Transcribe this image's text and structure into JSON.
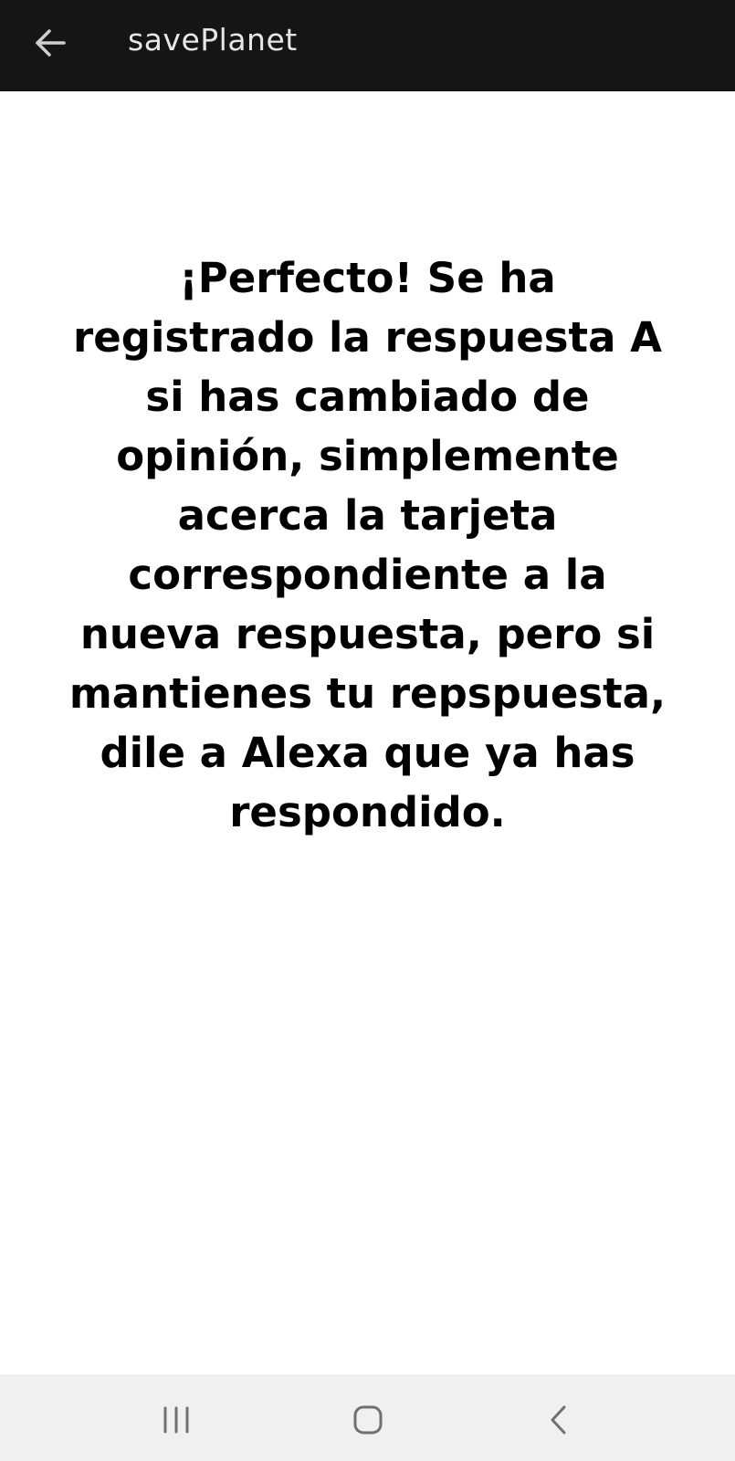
{
  "app_bar": {
    "title": "savePlanet",
    "back_icon": "arrow-left-icon"
  },
  "main": {
    "message": "¡Perfecto! Se ha registrado la respuesta A si has cambiado de opinión, simplemente acerca la tarjeta correspondiente a la nueva respuesta, pero si mantienes tu repspuesta, dile a Alexa que ya has respondido."
  },
  "system_nav": {
    "recents_icon": "recents-icon",
    "home_icon": "home-icon",
    "back_icon": "chevron-left-icon"
  },
  "colors": {
    "app_bar_bg": "#151515",
    "app_bar_text": "#e6e6e6",
    "body_bg": "#ffffff",
    "message_text": "#000000",
    "nav_bar_bg": "#f0f0f0",
    "nav_icon": "#707070"
  }
}
